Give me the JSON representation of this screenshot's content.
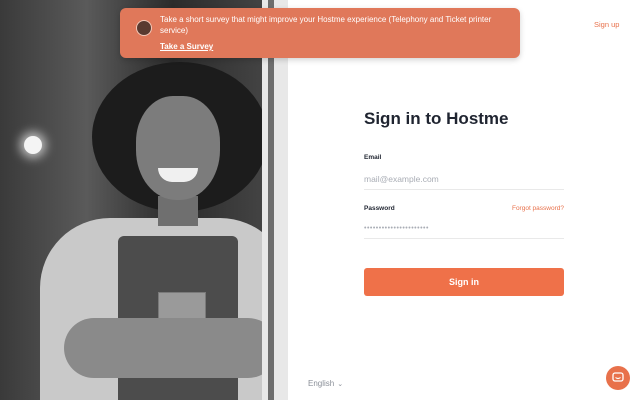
{
  "banner": {
    "message": "Take a short survey that might improve your Hostme experience (Telephony and Ticket printer service)",
    "link_label": "Take a Survey"
  },
  "header": {
    "signup_label": "Sign up"
  },
  "form": {
    "title": "Sign in to Hostme",
    "email_label": "Email",
    "email_placeholder": "mail@example.com",
    "password_label": "Password",
    "forgot_label": "Forgot password?",
    "password_value": "••••••••••••••••••••••",
    "submit_label": "Sign in"
  },
  "footer": {
    "language": "English"
  },
  "colors": {
    "accent": "#ef7149",
    "banner": "#e0785a"
  },
  "icons": {
    "chat": "chat-icon",
    "language_chevron": "chevron-down-icon"
  }
}
